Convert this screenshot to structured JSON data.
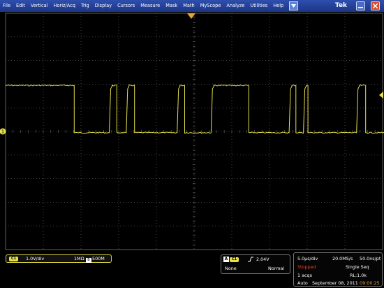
{
  "menu": {
    "items": [
      "File",
      "Edit",
      "Vertical",
      "Horiz/Acq",
      "Trig",
      "Display",
      "Cursors",
      "Measure",
      "Mask",
      "Math",
      "MyScope",
      "Analyze",
      "Utilities",
      "Help"
    ],
    "brand": "Tek"
  },
  "markers": {
    "ch1_ground": "1"
  },
  "channel1": {
    "badge": "C1",
    "scale": "1.0V/div",
    "impedance": "1MΩ",
    "bw_icon": "B",
    "bandwidth": "500M",
    "color": "#e6e04a"
  },
  "trigger": {
    "badge_a": "A",
    "source_badge": "C1",
    "slope_icon": "rising-edge-icon",
    "level": "2.04V",
    "source": "None",
    "mode": "Normal"
  },
  "acquisition": {
    "horizontal_scale": "5.0µs/div",
    "sample_rate": "20.0MS/s",
    "resolution": "50.0ns/pt",
    "state": "Stopped",
    "sequence": "Single Seq",
    "acqs": "1 acqs",
    "record_length": "RL:1.0k",
    "mode": "Auto",
    "date": "September 08, 2011",
    "time": "09:00:25"
  },
  "waveform": {
    "color": "#e6e04a",
    "low_level_div": -1.0,
    "high_level_div": 1.0,
    "initial_state": "high",
    "transitions_div": [
      [
        0.0,
        "high"
      ],
      [
        1.82,
        "low"
      ],
      [
        2.75,
        "high"
      ],
      [
        2.95,
        "low"
      ],
      [
        3.2,
        "high"
      ],
      [
        3.42,
        "low"
      ],
      [
        4.55,
        "high"
      ],
      [
        4.75,
        "low"
      ],
      [
        5.45,
        "high"
      ],
      [
        6.45,
        "low"
      ],
      [
        7.52,
        "high"
      ],
      [
        7.7,
        "low"
      ],
      [
        7.9,
        "high"
      ],
      [
        8.02,
        "low"
      ],
      [
        9.31,
        "high"
      ],
      [
        9.55,
        "low"
      ],
      [
        10.11,
        "high"
      ],
      [
        10.3,
        "low"
      ]
    ]
  }
}
